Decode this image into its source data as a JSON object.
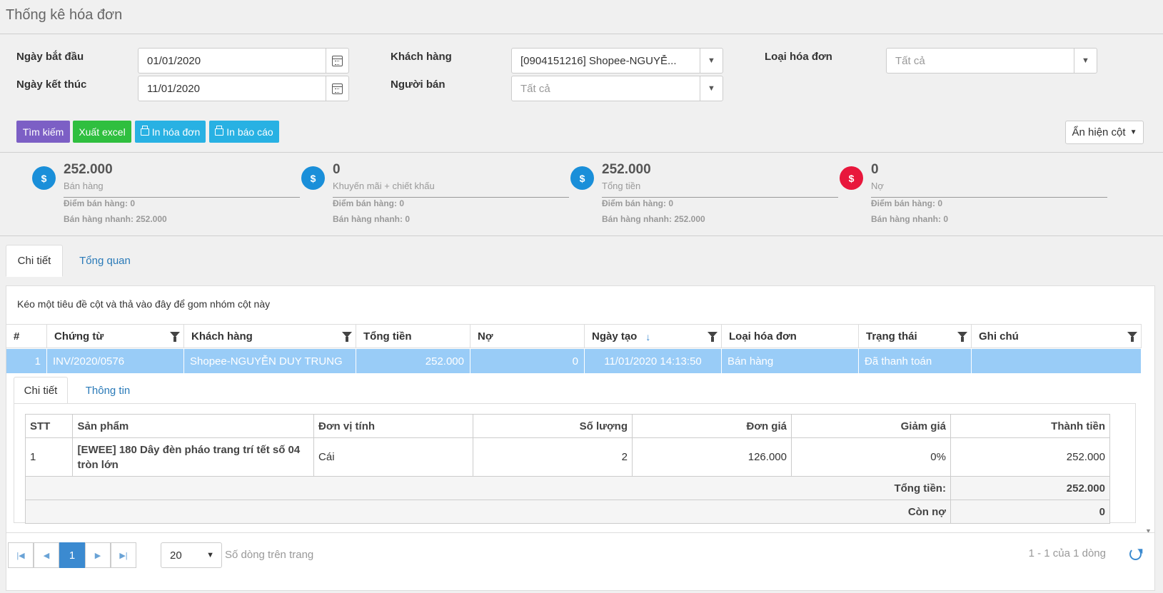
{
  "page": {
    "title": "Thống kê hóa đơn"
  },
  "filters": {
    "start_date_label": "Ngày bắt đầu",
    "start_date_value": "01/01/2020",
    "end_date_label": "Ngày kết thúc",
    "end_date_value": "11/01/2020",
    "customer_label": "Khách hàng",
    "customer_value": "[0904151216] Shopee-NGUYỄ...",
    "seller_label": "Người bán",
    "seller_placeholder": "Tất cả",
    "invoice_type_label": "Loại hóa đơn",
    "invoice_type_placeholder": "Tất cả"
  },
  "buttons": {
    "search": "Tìm kiếm",
    "export_excel": "Xuất excel",
    "print_invoice": "In hóa đơn",
    "print_report": "In báo cáo",
    "toggle_columns": "Ẩn hiện cột"
  },
  "stats": [
    {
      "value": "252.000",
      "label": "Bán hàng",
      "line1": "Điểm bán hàng: 0",
      "line2": "Bán hàng nhanh: 252.000",
      "color": "#1a8fd9",
      "icon": "dollar-icon"
    },
    {
      "value": "0",
      "label": "Khuyến mãi + chiết khấu",
      "line1": "Điểm bán hàng: 0",
      "line2": "Bán hàng nhanh: 0",
      "color": "#1a8fd9",
      "icon": "dollar-icon"
    },
    {
      "value": "252.000",
      "label": "Tổng tiền",
      "line1": "Điểm bán hàng: 0",
      "line2": "Bán hàng nhanh: 252.000",
      "color": "#1a8fd9",
      "icon": "dollar-icon"
    },
    {
      "value": "0",
      "label": "Nợ",
      "line1": "Điểm bán hàng: 0",
      "line2": "Bán hàng nhanh: 0",
      "color": "#e8173c",
      "icon": "dollar-icon"
    }
  ],
  "main_tabs": [
    "Chi tiết",
    "Tổng quan"
  ],
  "grid": {
    "group_hint": "Kéo một tiêu đề cột và thả vào đây để gom nhóm cột này",
    "columns": [
      "#",
      "Chứng từ",
      "Khách hàng",
      "Tổng tiền",
      "Nợ",
      "Ngày tạo",
      "Loại hóa đơn",
      "Trạng thái",
      "Ghi chú"
    ],
    "rows": [
      {
        "idx": "1",
        "voucher": "INV/2020/0576",
        "customer": "Shopee-NGUYỄN DUY TRUNG",
        "total": "252.000",
        "debt": "0",
        "created": "11/01/2020 14:13:50",
        "type": "Bán hàng",
        "status": "Đã thanh toán",
        "note": ""
      }
    ]
  },
  "detail": {
    "tabs": [
      "Chi tiết",
      "Thông tin"
    ],
    "columns": [
      "STT",
      "Sản phẩm",
      "Đơn vị tính",
      "Số lượng",
      "Đơn giá",
      "Giảm giá",
      "Thành tiền"
    ],
    "items": [
      {
        "stt": "1",
        "product": "[EWEE] 180 Dây đèn pháo trang trí tết số 04 tròn lớn",
        "unit": "Cái",
        "qty": "2",
        "price": "126.000",
        "discount": "0%",
        "amount": "252.000"
      }
    ],
    "total_label": "Tổng tiền:",
    "total_value": "252.000",
    "remaining_label": "Còn nợ",
    "remaining_value": "0"
  },
  "pager": {
    "current_page": "1",
    "page_size": "20",
    "page_size_label": "Số dòng trên trang",
    "info": "1 - 1 của 1 dòng"
  }
}
